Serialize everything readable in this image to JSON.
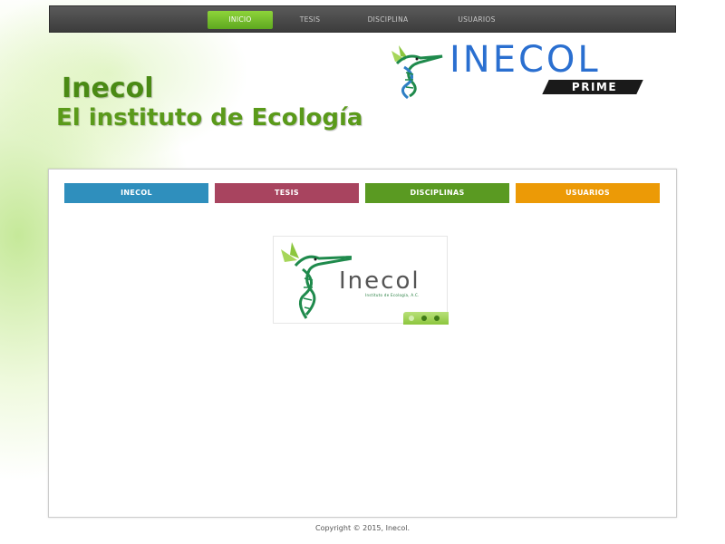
{
  "nav": {
    "items": [
      {
        "label": "INICIO",
        "active": true
      },
      {
        "label": "TESIS",
        "active": false
      },
      {
        "label": "DISCIPLINA",
        "active": false
      },
      {
        "label": "USUARIOS",
        "active": false
      }
    ]
  },
  "header": {
    "logo_text": "INECOL",
    "logo_badge": "PRIME",
    "title": "Inecol",
    "subtitle": "El instituto de Ecología"
  },
  "tiles": [
    {
      "label": "INECOL",
      "color": "#2f8fbd"
    },
    {
      "label": "TESIS",
      "color": "#a8445f"
    },
    {
      "label": "DISCIPLINAS",
      "color": "#5a9a22"
    },
    {
      "label": "USUARIOS",
      "color": "#ec9a06"
    }
  ],
  "slider": {
    "logo_text": "Inecol",
    "tagline": "Instituto de Ecología, A.C.",
    "dots": 3,
    "active_dot": 0
  },
  "footer": {
    "copyright": "Copyright © 2015, Inecol."
  },
  "colors": {
    "nav_active": "#6fbf2a",
    "brand_blue": "#2a6fd0",
    "brand_green": "#4a8a14"
  }
}
